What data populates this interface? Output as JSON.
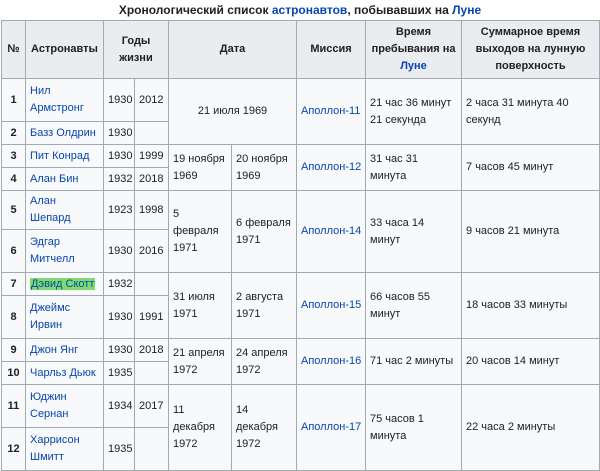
{
  "caption": {
    "before": "Хронологический список ",
    "link1": "астронавтов",
    "middle": ", побывавших на ",
    "link2": "Луне"
  },
  "headers": {
    "num": "№",
    "astronauts": "Астронавты",
    "years": "Годы жизни",
    "date": "Дата",
    "mission": "Миссия",
    "time_before": "Время пребывания на",
    "time_link": "Луне",
    "eva": "Суммарное время выходов на лунную поверхность"
  },
  "rows": [
    {
      "num": "1",
      "name": "Нил Армстронг",
      "born": "1930",
      "died": "2012",
      "date": "21 июля 1969",
      "mission": "Аполлон-11",
      "time": "21 час 36 минут 21 секунда",
      "eva": "2 часа 31 минута 40 секунд"
    },
    {
      "num": "2",
      "name": "Базз Олдрин",
      "born": "1930",
      "died": ""
    },
    {
      "num": "3",
      "name": "Пит Конрад",
      "born": "1930",
      "died": "1999",
      "date_start": "19 ноября 1969",
      "date_end": "20 ноября 1969",
      "mission": "Аполлон-12",
      "time": "31 час 31 минута",
      "eva": "7 часов 45 минут"
    },
    {
      "num": "4",
      "name": "Алан Бин",
      "born": "1932",
      "died": "2018"
    },
    {
      "num": "5",
      "name": "Алан Шепард",
      "born": "1923",
      "died": "1998",
      "date_start": "5 февраля 1971",
      "date_end": "6 февраля 1971",
      "mission": "Аполлон-14",
      "time": "33 часа 14 минут",
      "eva": "9 часов 21 минута"
    },
    {
      "num": "6",
      "name": "Эдгар Митчелл",
      "born": "1930",
      "died": "2016"
    },
    {
      "num": "7",
      "name": "Дэвид Скотт",
      "born": "1932",
      "died": "",
      "date_start": "31 июля 1971",
      "date_end": "2 августа 1971",
      "mission": "Аполлон-15",
      "time": "66 часов 55 минут",
      "eva": "18 часов 33 минуты"
    },
    {
      "num": "8",
      "name": "Джеймс Ирвин",
      "born": "1930",
      "died": "1991"
    },
    {
      "num": "9",
      "name": "Джон Янг",
      "born": "1930",
      "died": "2018",
      "date_start": "21 апреля 1972",
      "date_end": "24 апреля 1972",
      "mission": "Аполлон-16",
      "time": "71 час 2 минуты",
      "eva": "20 часов 14 минут"
    },
    {
      "num": "10",
      "name": "Чарльз Дьюк",
      "born": "1935",
      "died": ""
    },
    {
      "num": "11",
      "name": "Юджин Сернан",
      "born": "1934",
      "died": "2017",
      "date_start": "11 декабря 1972",
      "date_end": "14 декабря 1972",
      "mission": "Аполлон-17",
      "time": "75 часов 1 минута",
      "eva": "22 часа 2 минуты"
    },
    {
      "num": "12",
      "name": "Харрисон Шмитт",
      "born": "1935",
      "died": ""
    }
  ],
  "colors": {
    "link": "#0645ad",
    "highlight": "#7ddb6f",
    "header_bg": "#eaecf0",
    "cell_bg": "#f8f9fa",
    "border": "#a2a9b1"
  }
}
